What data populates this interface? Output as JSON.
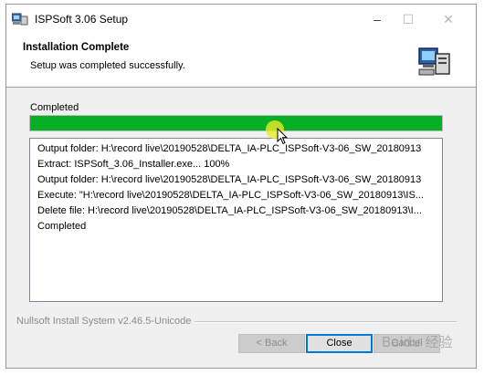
{
  "window": {
    "title": "ISPSoft 3.06 Setup"
  },
  "header": {
    "title": "Installation Complete",
    "subtitle": "Setup was completed successfully."
  },
  "progress": {
    "label": "Completed",
    "value": 1.0,
    "color": "#06b025"
  },
  "log": {
    "lines": [
      "Output folder: H:\\record live\\20190528\\DELTA_IA-PLC_ISPSoft-V3-06_SW_20180913",
      "Extract: ISPSoft_3.06_Installer.exe... 100%",
      "Output folder: H:\\record live\\20190528\\DELTA_IA-PLC_ISPSoft-V3-06_SW_20180913",
      "Execute: \"H:\\record live\\20190528\\DELTA_IA-PLC_ISPSoft-V3-06_SW_20180913\\IS...",
      "Delete file: H:\\record live\\20190528\\DELTA_IA-PLC_ISPSoft-V3-06_SW_20180913\\I...",
      "Completed"
    ]
  },
  "footer": {
    "branding": "Nullsoft Install System v2.46.5-Unicode"
  },
  "buttons": {
    "back": "< Back",
    "close": "Close",
    "cancel": "Cancel"
  },
  "watermark": "Baidu 经验",
  "icons": {
    "app": "installer-computer-icon",
    "header": "installer-computer-icon",
    "minimize": "minimize-icon",
    "maximize": "maximize-icon",
    "close": "close-icon"
  }
}
